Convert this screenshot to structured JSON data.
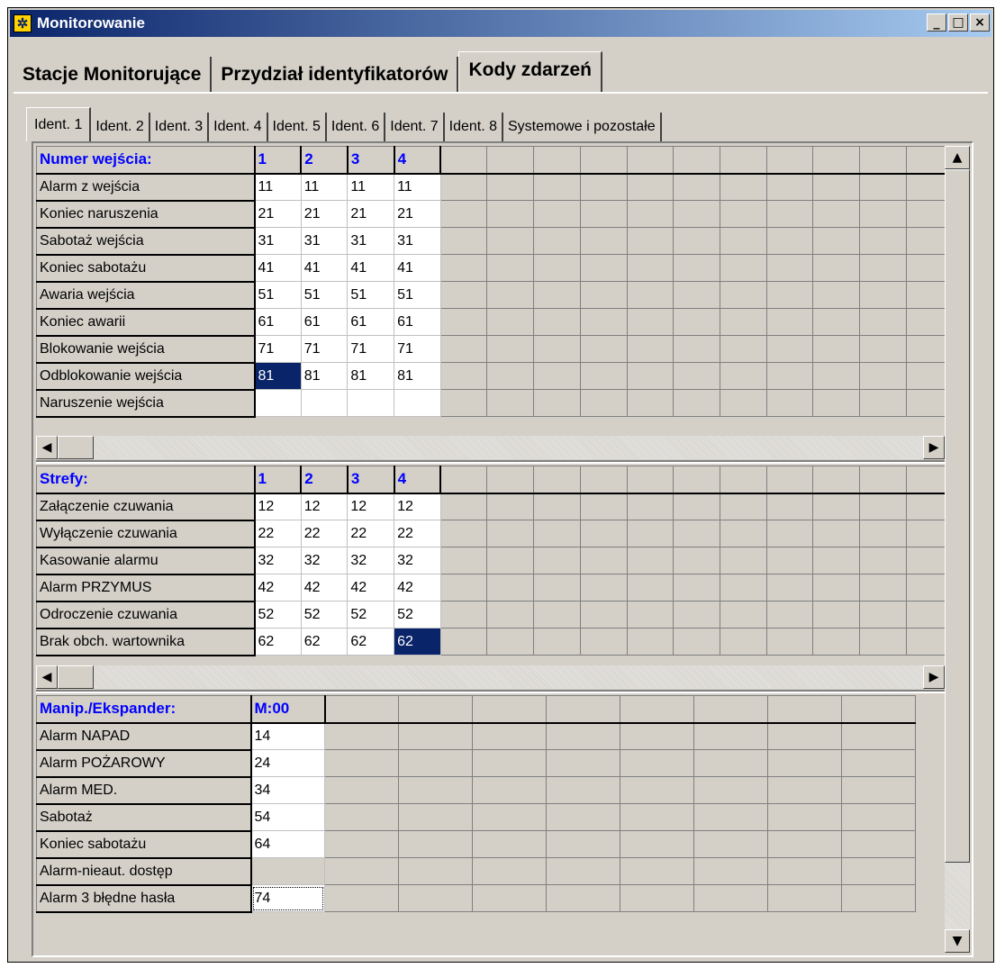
{
  "window": {
    "title": "Monitorowanie",
    "minimize": "_",
    "maximize": "□",
    "close": "×"
  },
  "main_tabs": [
    {
      "label": "Stacje Monitorujące",
      "active": false
    },
    {
      "label": "Przydział identyfikatorów",
      "active": false
    },
    {
      "label": "Kody zdarzeń",
      "active": true
    }
  ],
  "sub_tabs": [
    {
      "label": "Ident. 1",
      "active": true
    },
    {
      "label": "Ident. 2",
      "active": false
    },
    {
      "label": "Ident. 3",
      "active": false
    },
    {
      "label": "Ident. 4",
      "active": false
    },
    {
      "label": "Ident. 5",
      "active": false
    },
    {
      "label": "Ident. 6",
      "active": false
    },
    {
      "label": "Ident. 7",
      "active": false
    },
    {
      "label": "Ident. 8",
      "active": false
    },
    {
      "label": "Systemowe i pozostałe",
      "active": false
    }
  ],
  "inputs_grid": {
    "header": "Numer wejścia:",
    "columns": [
      "1",
      "2",
      "3",
      "4"
    ],
    "rows": [
      {
        "label": "Alarm z wejścia",
        "values": [
          "11",
          "11",
          "11",
          "11"
        ]
      },
      {
        "label": "Koniec naruszenia",
        "values": [
          "21",
          "21",
          "21",
          "21"
        ]
      },
      {
        "label": "Sabotaż wejścia",
        "values": [
          "31",
          "31",
          "31",
          "31"
        ]
      },
      {
        "label": "Koniec sabotażu",
        "values": [
          "41",
          "41",
          "41",
          "41"
        ]
      },
      {
        "label": "Awaria wejścia",
        "values": [
          "51",
          "51",
          "51",
          "51"
        ]
      },
      {
        "label": "Koniec awarii",
        "values": [
          "61",
          "61",
          "61",
          "61"
        ]
      },
      {
        "label": "Blokowanie wejścia",
        "values": [
          "71",
          "71",
          "71",
          "71"
        ]
      },
      {
        "label": "Odblokowanie wejścia",
        "values": [
          "81",
          "81",
          "81",
          "81"
        ]
      },
      {
        "label": "Naruszenie wejścia",
        "values": [
          "",
          "",
          "",
          ""
        ]
      }
    ],
    "selected_cell": {
      "row": 7,
      "col": 0
    }
  },
  "zones_grid": {
    "header": "Strefy:",
    "columns": [
      "1",
      "2",
      "3",
      "4"
    ],
    "rows": [
      {
        "label": "Załączenie czuwania",
        "values": [
          "12",
          "12",
          "12",
          "12"
        ]
      },
      {
        "label": "Wyłączenie czuwania",
        "values": [
          "22",
          "22",
          "22",
          "22"
        ]
      },
      {
        "label": "Kasowanie alarmu",
        "values": [
          "32",
          "32",
          "32",
          "32"
        ]
      },
      {
        "label": "Alarm PRZYMUS",
        "values": [
          "42",
          "42",
          "42",
          "42"
        ]
      },
      {
        "label": "Odroczenie czuwania",
        "values": [
          "52",
          "52",
          "52",
          "52"
        ]
      },
      {
        "label": "Brak obch. wartownika",
        "values": [
          "62",
          "62",
          "62",
          "62"
        ]
      }
    ],
    "selected_cell": {
      "row": 5,
      "col": 3
    }
  },
  "keypad_grid": {
    "header": "Manip./Ekspander:",
    "columns": [
      "M:00"
    ],
    "rows": [
      {
        "label": "Alarm NAPAD",
        "values": [
          "14"
        ]
      },
      {
        "label": "Alarm POŻAROWY",
        "values": [
          "24"
        ]
      },
      {
        "label": "Alarm MED.",
        "values": [
          "34"
        ]
      },
      {
        "label": "Sabotaż",
        "values": [
          "54"
        ]
      },
      {
        "label": "Koniec sabotażu",
        "values": [
          "64"
        ]
      },
      {
        "label": "Alarm-nieaut. dostęp",
        "values": [
          ""
        ]
      },
      {
        "label": "Alarm 3 błędne hasła",
        "values": [
          "74"
        ]
      }
    ],
    "focused_cell": {
      "row": 6,
      "col": 0
    }
  },
  "scroll": {
    "left_arrow": "◀",
    "right_arrow": "▶",
    "up_arrow": "▲",
    "down_arrow": "▼"
  }
}
